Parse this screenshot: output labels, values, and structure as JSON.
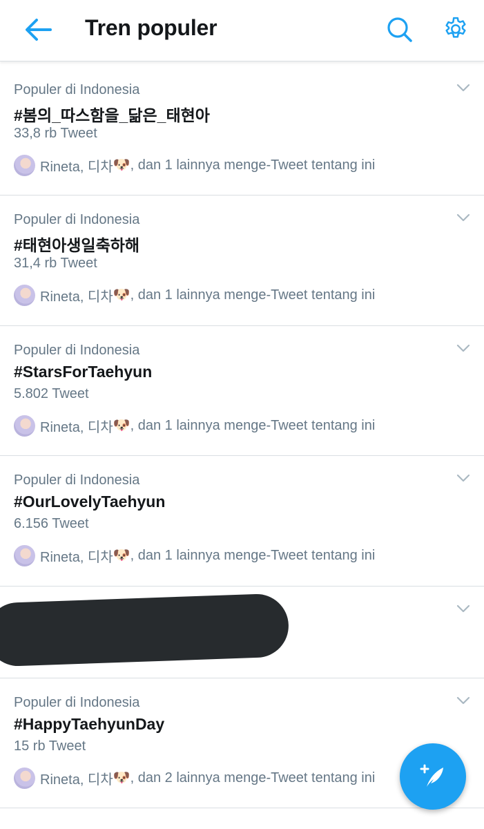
{
  "header": {
    "title": "Tren populer",
    "back_icon": "arrow-left-icon",
    "search_icon": "search-icon",
    "settings_icon": "gear-icon"
  },
  "colors": {
    "accent": "#1da1f2",
    "text_primary": "#14171a",
    "text_secondary": "#657786",
    "divider": "#d9dee2",
    "redaction": "#272b2e"
  },
  "social_common": {
    "names_prefix": "Rineta, 디차",
    "dog_emoji": "🐶"
  },
  "trends": [
    {
      "context": "Populer di Indonesia",
      "name": "#봄의_따스함을_닮은_태현아",
      "count": "33,8 rb Tweet",
      "social_suffix": ", dan 1 lainnya menge-Tweet tentang ini"
    },
    {
      "context": "Populer di Indonesia",
      "name": "#태현아생일축하해",
      "count": "31,4 rb Tweet",
      "social_suffix": ", dan 1 lainnya menge-Tweet tentang ini"
    },
    {
      "context": "Populer di Indonesia",
      "name": "#StarsForTaehyun",
      "count": "5.802 Tweet",
      "social_suffix": ", dan 1 lainnya menge-Tweet tentang ini"
    },
    {
      "context": "Populer di Indonesia",
      "name": "#OurLovelyTaehyun",
      "count": "6.156 Tweet",
      "social_suffix": ", dan 1 lainnya menge-Tweet tentang ini"
    },
    {
      "redacted": true
    },
    {
      "context": "Populer di Indonesia",
      "name": "#HappyTaehyunDay",
      "count": "15 rb Tweet",
      "social_suffix": ", dan 2 lainnya menge-Tweet tentang ini"
    }
  ],
  "fab": {
    "icon": "compose-tweet-icon"
  }
}
